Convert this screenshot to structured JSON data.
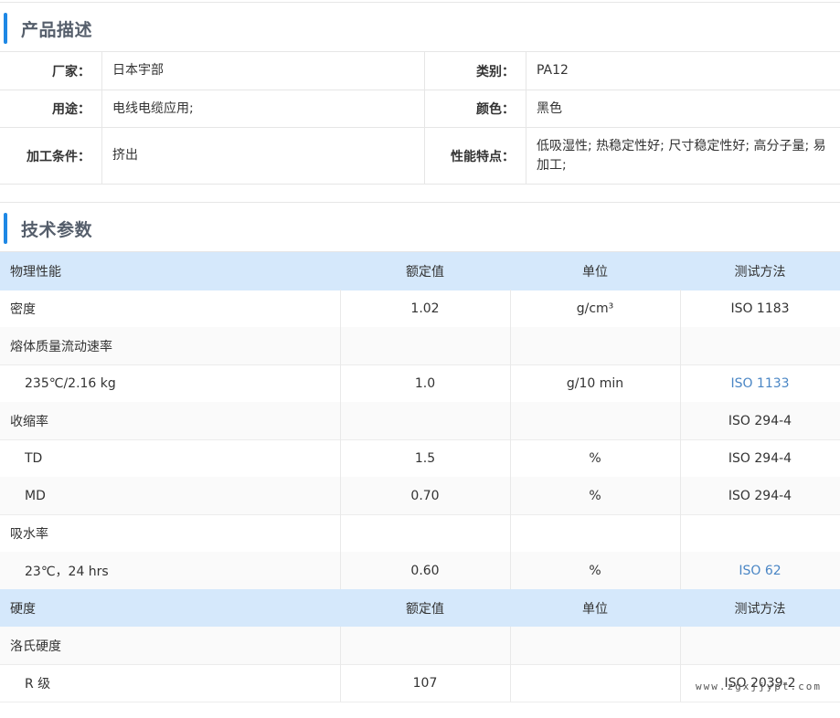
{
  "product_description": {
    "title": "产品描述",
    "rows": [
      {
        "label1": "厂家：",
        "value1": "日本宇部",
        "label2": "类别：",
        "value2": "PA12"
      },
      {
        "label1": "用途：",
        "value1": "电线电缆应用;",
        "label2": "颜色：",
        "value2": "黑色"
      },
      {
        "label1": "加工条件：",
        "value1": "挤出",
        "label2": "性能特点：",
        "value2": "低吸湿性; 热稳定性好; 尺寸稳定性好; 高分子量; 易加工;"
      }
    ]
  },
  "tech_params": {
    "title": "技术参数",
    "rows": [
      {
        "type": "header",
        "c0": "物理性能",
        "c1": "额定值",
        "c2": "单位",
        "c3": "测试方法"
      },
      {
        "type": "row",
        "c0": "密度",
        "c1": "1.02",
        "c2": "g/cm³",
        "c3": "ISO 1183"
      },
      {
        "type": "group",
        "c0": "熔体质量流动速率",
        "c1": "",
        "c2": "",
        "c3": ""
      },
      {
        "type": "sub",
        "c0": "235℃/2.16 kg",
        "c1": "1.0",
        "c2": "g/10 min",
        "c3": "ISO 1133",
        "link": true
      },
      {
        "type": "group",
        "c0": "收缩率",
        "c1": "",
        "c2": "",
        "c3": "ISO 294-4"
      },
      {
        "type": "sub",
        "c0": "TD",
        "c1": "1.5",
        "c2": "%",
        "c3": "ISO 294-4"
      },
      {
        "type": "sub",
        "c0": "MD",
        "c1": "0.70",
        "c2": "%",
        "c3": "ISO 294-4"
      },
      {
        "type": "group",
        "c0": "吸水率",
        "c1": "",
        "c2": "",
        "c3": ""
      },
      {
        "type": "sub",
        "c0": "23℃，24 hrs",
        "c1": "0.60",
        "c2": "%",
        "c3": "ISO 62",
        "link": true
      },
      {
        "type": "header",
        "c0": "硬度",
        "c1": "额定值",
        "c2": "单位",
        "c3": "测试方法"
      },
      {
        "type": "group",
        "c0": "洛氏硬度",
        "c1": "",
        "c2": "",
        "c3": ""
      },
      {
        "type": "sub",
        "c0": "R 级",
        "c1": "107",
        "c2": "",
        "c3": "ISO 2039-2"
      }
    ]
  },
  "watermark": "www.zgxjjypt.com"
}
